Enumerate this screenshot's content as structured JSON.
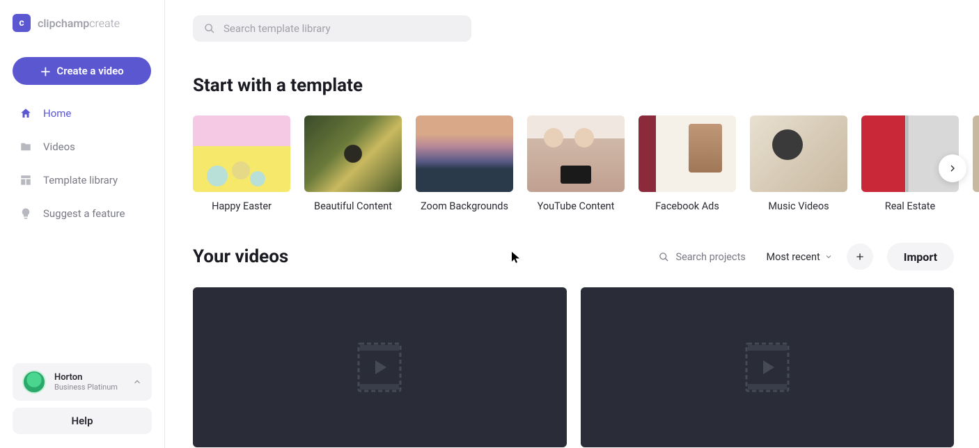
{
  "brand": {
    "logo_letter": "c",
    "name_main": "clipchamp",
    "name_sub": "create"
  },
  "sidebar": {
    "create_label": "Create a video",
    "nav": [
      {
        "label": "Home",
        "icon": "home-icon",
        "active": true
      },
      {
        "label": "Videos",
        "icon": "folder-icon",
        "active": false
      },
      {
        "label": "Template library",
        "icon": "template-icon",
        "active": false
      },
      {
        "label": "Suggest a feature",
        "icon": "lightbulb-icon",
        "active": false
      }
    ],
    "user": {
      "name": "Horton",
      "plan": "Business Platinum"
    },
    "help_label": "Help"
  },
  "search": {
    "placeholder": "Search template library"
  },
  "sections": {
    "templates_title": "Start with a template",
    "videos_title": "Your videos"
  },
  "templates": [
    {
      "label": "Happy Easter"
    },
    {
      "label": "Beautiful Content"
    },
    {
      "label": "Zoom Backgrounds"
    },
    {
      "label": "YouTube Content"
    },
    {
      "label": "Facebook Ads"
    },
    {
      "label": "Music Videos"
    },
    {
      "label": "Real Estate"
    }
  ],
  "videos_controls": {
    "search_placeholder": "Search projects",
    "sort_label": "Most recent",
    "import_label": "Import"
  },
  "colors": {
    "accent": "#5b57d1",
    "bg_muted": "#f4f4f6"
  }
}
